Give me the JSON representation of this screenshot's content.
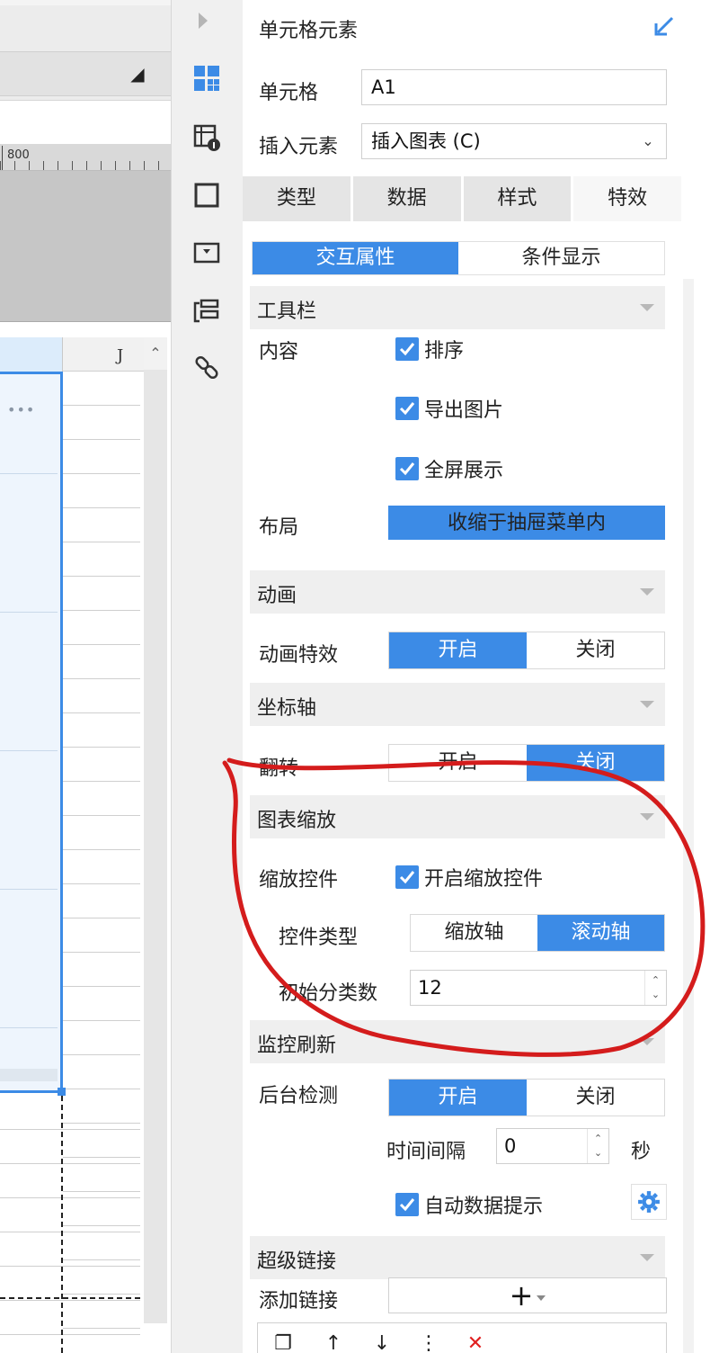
{
  "left": {
    "ruler_label": "800",
    "column_label": "J",
    "more_dots": "•••"
  },
  "panel": {
    "title": "单元格元素",
    "cell_label": "单元格",
    "cell_value": "A1",
    "insert_label": "插入元素",
    "insert_value": "插入图表 (C)",
    "tabs": [
      "类型",
      "数据",
      "样式",
      "特效"
    ],
    "active_tab": "特效",
    "subtabs": [
      "交互属性",
      "条件显示"
    ],
    "toolbar_section": {
      "title": "工具栏",
      "content_label": "内容",
      "checks": [
        "排序",
        "导出图片",
        "全屏展示"
      ],
      "layout_label": "布局",
      "layout_value": "收缩于抽屉菜单内"
    },
    "animation_section": {
      "title": "动画",
      "label": "动画特效",
      "on": "开启",
      "off": "关闭",
      "selected": "开启"
    },
    "axis_section": {
      "title": "坐标轴",
      "label": "翻转",
      "on": "开启",
      "off": "关闭",
      "selected": "关闭"
    },
    "zoom_section": {
      "title": "图表缩放",
      "control_label": "缩放控件",
      "control_check": "开启缩放控件",
      "type_label": "控件类型",
      "type_opt1": "缩放轴",
      "type_opt2": "滚动轴",
      "type_selected": "滚动轴",
      "init_label": "初始分类数",
      "init_value": "12"
    },
    "monitor_section": {
      "title": "监控刷新",
      "label": "后台检测",
      "on": "开启",
      "off": "关闭",
      "selected": "开启",
      "interval_label": "时间间隔",
      "interval_value": "0",
      "interval_unit": "秒",
      "auto_tip": "自动数据提示"
    },
    "link_section": {
      "title": "超级链接",
      "add_label": "添加链接"
    }
  },
  "icons": {
    "accent": "#3c8be6",
    "annotation": "#d41c1c"
  }
}
